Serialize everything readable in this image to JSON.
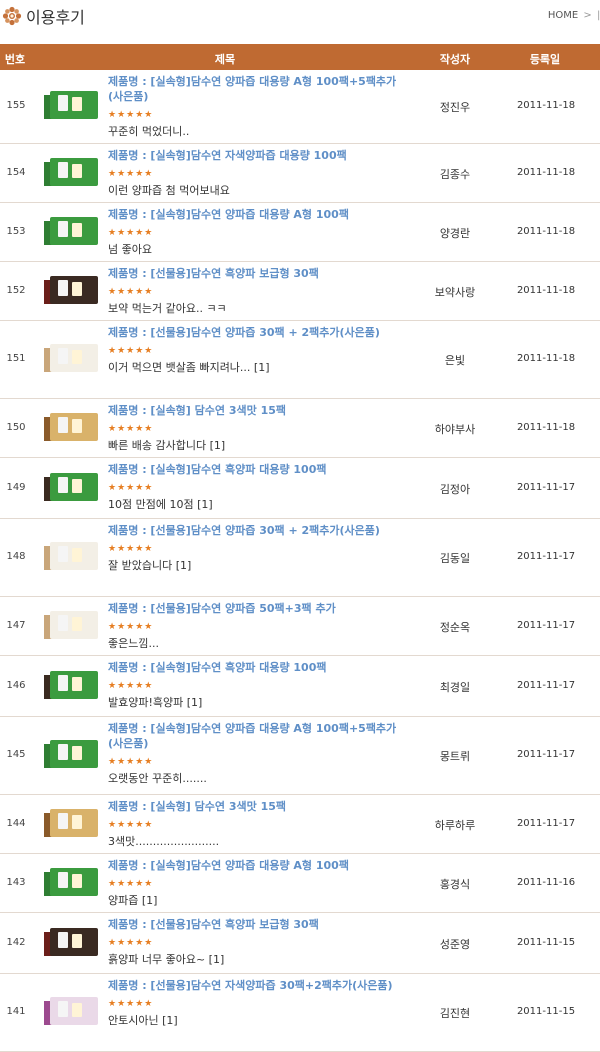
{
  "page": {
    "title": "이용후기",
    "breadcrumb": {
      "home": "HOME",
      "sep": ">"
    }
  },
  "table": {
    "headers": {
      "num": "번호",
      "title": "제목",
      "author": "작성자",
      "date": "등록일"
    },
    "rows": [
      {
        "num": "155",
        "product": "제품명 : [실속형]담수연 양파즙 대용량 A형 100팩+5팩추가(사은품)",
        "stars": "★★★★★",
        "comment": "꾸준히 먹었더니..",
        "author": "정진우",
        "date": "2011-11-18",
        "thumb": "green-box"
      },
      {
        "num": "154",
        "product": "제품명 : [실속형]담수연 자색양파즙 대용량 100팩",
        "stars": "★★★★★",
        "comment": "이런 양파즙 첨 먹어보내요",
        "author": "김종수",
        "date": "2011-11-18",
        "thumb": "green-box"
      },
      {
        "num": "153",
        "product": "제품명 : [실속형]담수연 양파즙 대용량 A형 100팩",
        "stars": "★★★★★",
        "comment": "넘 좋아요",
        "author": "양경란",
        "date": "2011-11-18",
        "thumb": "green-box"
      },
      {
        "num": "152",
        "product": "제품명 : [선물용]담수연 흑양파 보급형 30팩",
        "stars": "★★★★★",
        "comment": "보약 먹는거 같아요.. ㅋㅋ",
        "author": "보약사랑",
        "date": "2011-11-18",
        "thumb": "dark-box"
      },
      {
        "num": "151",
        "product": "제품명 : [선물용]담수연 양파즙 30팩 + 2팩추가(사은품)",
        "stars": "★★★★★",
        "comment": "이거 먹으면 뱃살좀 빠지려나... [1]",
        "author": "은빛",
        "date": "2011-11-18",
        "thumb": "white-pack"
      },
      {
        "num": "150",
        "product": "제품명 : [실속형] 담수연 3색맛 15팩",
        "stars": "★★★★★",
        "comment": "빠른 배송 감사합니다 [1]",
        "author": "하야부사",
        "date": "2011-11-18",
        "thumb": "tan-box"
      },
      {
        "num": "149",
        "product": "제품명 : [실속형]담수연 흑양파 대용량 100팩",
        "stars": "★★★★★",
        "comment": "10점 만점에 10점 [1]",
        "author": "김정아",
        "date": "2011-11-17",
        "thumb": "green-dark"
      },
      {
        "num": "148",
        "product": "제품명 : [선물용]담수연 양파즙 30팩 + 2팩추가(사은품)",
        "stars": "★★★★★",
        "comment": "잘 받았습니다 [1]",
        "author": "김동일",
        "date": "2011-11-17",
        "thumb": "white-pack"
      },
      {
        "num": "147",
        "product": "제품명 : [선물용]담수연 양파즙 50팩+3팩 추가",
        "stars": "★★★★★",
        "comment": "좋은느낌...",
        "author": "정순옥",
        "date": "2011-11-17",
        "thumb": "white-pack"
      },
      {
        "num": "146",
        "product": "제품명 : [실속형]담수연 흑양파 대용량 100팩",
        "stars": "★★★★★",
        "comment": "발효양파!흑양파 [1]",
        "author": "최경일",
        "date": "2011-11-17",
        "thumb": "green-dark"
      },
      {
        "num": "145",
        "product": "제품명 : [실속형]담수연 양파즙 대용량 A형 100팩+5팩추가(사은품)",
        "stars": "★★★★★",
        "comment": "오랫동안 꾸준히.......",
        "author": "몽트뤼",
        "date": "2011-11-17",
        "thumb": "green-box"
      },
      {
        "num": "144",
        "product": "제품명 : [실속형] 담수연 3색맛 15팩",
        "stars": "★★★★★",
        "comment": "3색맛........................",
        "author": "하루하루",
        "date": "2011-11-17",
        "thumb": "tan-box"
      },
      {
        "num": "143",
        "product": "제품명 : [실속형]담수연 양파즙 대용량 A형 100팩",
        "stars": "★★★★★",
        "comment": "양파즙 [1]",
        "author": "홍경식",
        "date": "2011-11-16",
        "thumb": "green-box"
      },
      {
        "num": "142",
        "product": "제품명 : [선물용]담수연 흑양파 보급형 30팩",
        "stars": "★★★★★",
        "comment": "흙양파 너무 좋아요~ [1]",
        "author": "성준영",
        "date": "2011-11-15",
        "thumb": "dark-box"
      },
      {
        "num": "141",
        "product": "제품명 : [선물용]담수연 자색양파즙 30팩+2팩추가(사은품)",
        "stars": "★★★★★",
        "comment": "안토시아닌 [1]",
        "author": "김진현",
        "date": "2011-11-15",
        "thumb": "purple-pack"
      }
    ]
  },
  "colors": {
    "header_bg": "#bf6a32",
    "product_title": "#5f8fc7",
    "stars": "#e67e22",
    "row_border": "#e3d9d0"
  }
}
